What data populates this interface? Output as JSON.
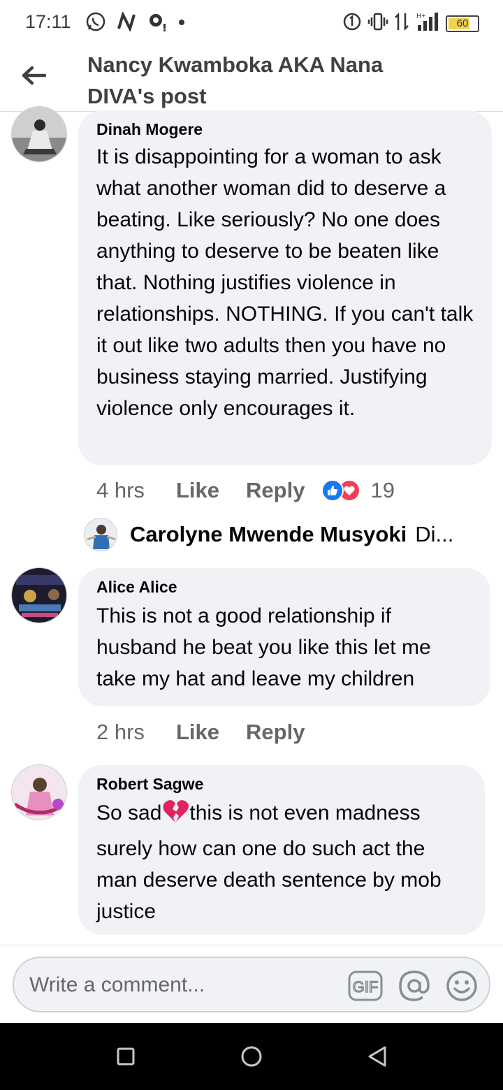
{
  "status": {
    "time": "17:11",
    "battery": "60"
  },
  "header": {
    "title": "Nancy Kwamboka AKA Nana DIVA's post"
  },
  "comments": [
    {
      "author": "Dinah Mogere",
      "text": "It is disappointing for a woman to ask what another woman did to deserve a beating. Like seriously? No one does anything to deserve to be beaten like that. Nothing justifies violence in relationships. NOTHING. If you can't talk it out like two adults then you have no business staying married. Justifying violence only encourages it.",
      "time": "4 hrs",
      "like": "Like",
      "reply": "Reply",
      "reaction_count": "19"
    },
    {
      "author": "Alice Alice",
      "text": "This is not a good relationship if husband he beat you like this let me take  my hat and leave my children",
      "time": "2 hrs",
      "like": "Like",
      "reply": "Reply"
    },
    {
      "author": "Robert Sagwe",
      "text_before": "So sad",
      "text_after": "this is not even madness surely how can one do such act the man deserve death sentence by mob justice"
    }
  ],
  "reply_preview": {
    "author": "Carolyne Mwende Musyoki",
    "snippet": "Di..."
  },
  "composer": {
    "placeholder": "Write a comment..."
  },
  "icons": {
    "back": "back-arrow-icon",
    "gif": "gif-icon",
    "mention": "at-mention-icon",
    "emoji": "emoji-icon",
    "broken_heart": "broken-heart-emoji"
  },
  "colors": {
    "like_blue": "#1877f2",
    "love_red": "#f33e58",
    "bubble_bg": "#f0f2f5"
  }
}
